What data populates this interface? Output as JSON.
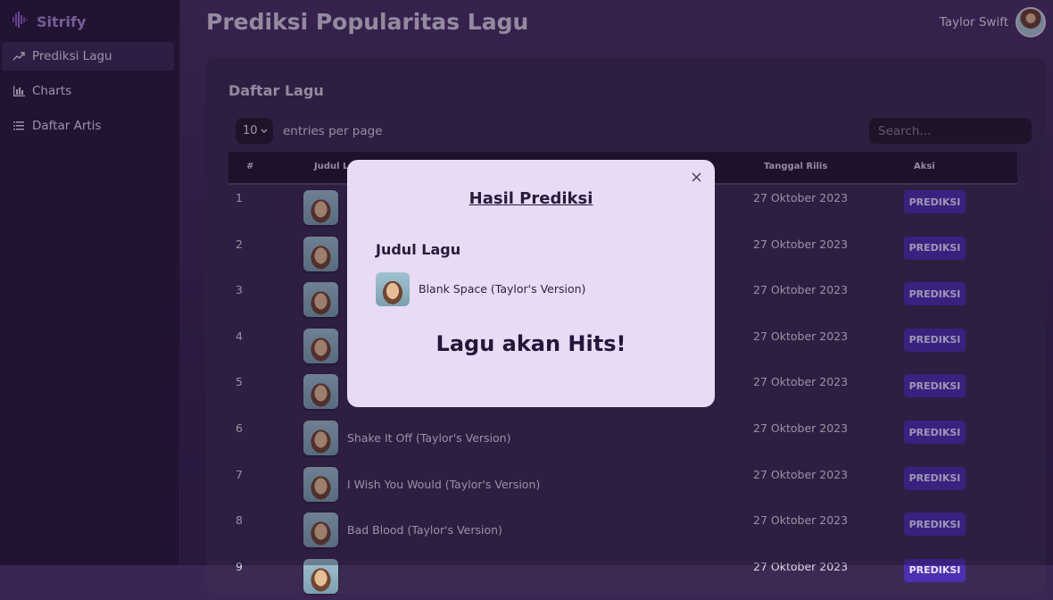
{
  "app": {
    "brand": "Sitrify"
  },
  "sidebar": {
    "items": [
      {
        "label": "Prediksi Lagu",
        "icon": "trending-up-icon",
        "active": true
      },
      {
        "label": "Charts",
        "icon": "bar-chart-icon",
        "active": false
      },
      {
        "label": "Daftar Artis",
        "icon": "list-icon",
        "active": false
      }
    ]
  },
  "header": {
    "title": "Prediksi Popularitas Lagu",
    "user_name": "Taylor Swift"
  },
  "card": {
    "title": "Daftar Lagu",
    "entries_value": "10",
    "entries_label": "entries per page",
    "search_placeholder": "Search..."
  },
  "table": {
    "headers": {
      "no": "#",
      "title": "Judul Lagu",
      "date": "Tanggal Rilis",
      "action": "Aksi"
    },
    "rows": [
      {
        "no": "1",
        "title": "",
        "date": "27 Oktober 2023",
        "action": "PREDIKSI"
      },
      {
        "no": "2",
        "title": "",
        "date": "27 Oktober 2023",
        "action": "PREDIKSI"
      },
      {
        "no": "3",
        "title": "",
        "date": "27 Oktober 2023",
        "action": "PREDIKSI"
      },
      {
        "no": "4",
        "title": "",
        "date": "27 Oktober 2023",
        "action": "PREDIKSI"
      },
      {
        "no": "5",
        "title": "",
        "date": "27 Oktober 2023",
        "action": "PREDIKSI"
      },
      {
        "no": "6",
        "title": "Shake It Off (Taylor's Version)",
        "date": "27 Oktober 2023",
        "action": "PREDIKSI"
      },
      {
        "no": "7",
        "title": "I Wish You Would (Taylor's Version)",
        "date": "27 Oktober 2023",
        "action": "PREDIKSI"
      },
      {
        "no": "8",
        "title": "Bad Blood (Taylor's Version)",
        "date": "27 Oktober 2023",
        "action": "PREDIKSI"
      },
      {
        "no": "9",
        "title": "",
        "date": "27 Oktober 2023",
        "action": "PREDIKSI"
      }
    ]
  },
  "modal": {
    "title": "Hasil Prediksi",
    "label": "Judul Lagu",
    "song": "Blank Space (Taylor's Version)",
    "result": "Lagu akan Hits!",
    "close_icon": "close-icon"
  },
  "colors": {
    "accent": "#4d2fb3",
    "brand": "#a98ad3",
    "sidebar": "#2a1a3c",
    "modal": "#e7dbf5"
  }
}
